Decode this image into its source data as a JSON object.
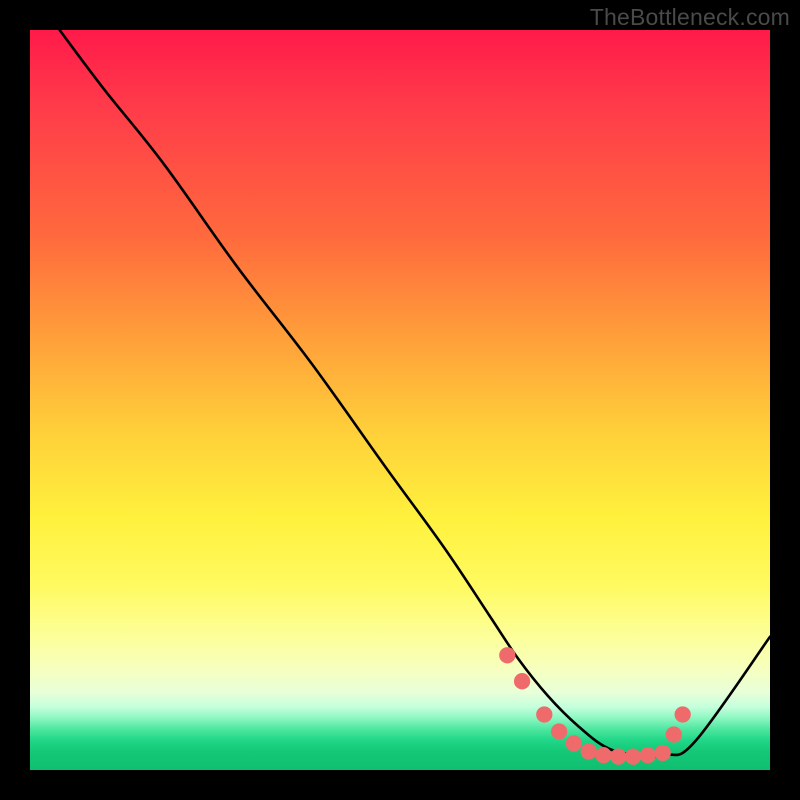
{
  "watermark": "TheBottleneck.com",
  "chart_data": {
    "type": "line",
    "title": "",
    "xlabel": "",
    "ylabel": "",
    "xlim": [
      0,
      100
    ],
    "ylim": [
      0,
      100
    ],
    "grid": false,
    "legend": false,
    "series": [
      {
        "name": "bottleneck-curve",
        "color": "#000000",
        "x": [
          4,
          10,
          18,
          28,
          38,
          48,
          56,
          62,
          66,
          70,
          74,
          78,
          82,
          86,
          90,
          100
        ],
        "y": [
          100,
          92,
          82,
          68,
          55,
          41,
          30,
          21,
          15,
          10,
          6,
          3,
          2,
          2,
          4,
          18
        ]
      }
    ],
    "markers": {
      "name": "optimum-region-dots",
      "color": "#ef6b6b",
      "radius_pct": 1.1,
      "x": [
        64.5,
        66.5,
        69.5,
        71.5,
        73.5,
        75.5,
        77.5,
        79.5,
        81.5,
        83.5,
        85.5,
        87.0,
        88.2
      ],
      "y": [
        15.5,
        12.0,
        7.5,
        5.2,
        3.6,
        2.5,
        2.0,
        1.8,
        1.8,
        2.0,
        2.3,
        4.8,
        7.5
      ]
    },
    "background": {
      "type": "vertical-gradient",
      "description": "smooth red->orange->yellow->pale->green from top to bottom",
      "stops": [
        {
          "pos": 0.0,
          "color": "#ff1a4a"
        },
        {
          "pos": 0.3,
          "color": "#ff7a3d"
        },
        {
          "pos": 0.55,
          "color": "#ffd23a"
        },
        {
          "pos": 0.75,
          "color": "#fffa60"
        },
        {
          "pos": 0.88,
          "color": "#edffd2"
        },
        {
          "pos": 0.94,
          "color": "#6ff0ae"
        },
        {
          "pos": 1.0,
          "color": "#0fbf70"
        }
      ]
    }
  }
}
